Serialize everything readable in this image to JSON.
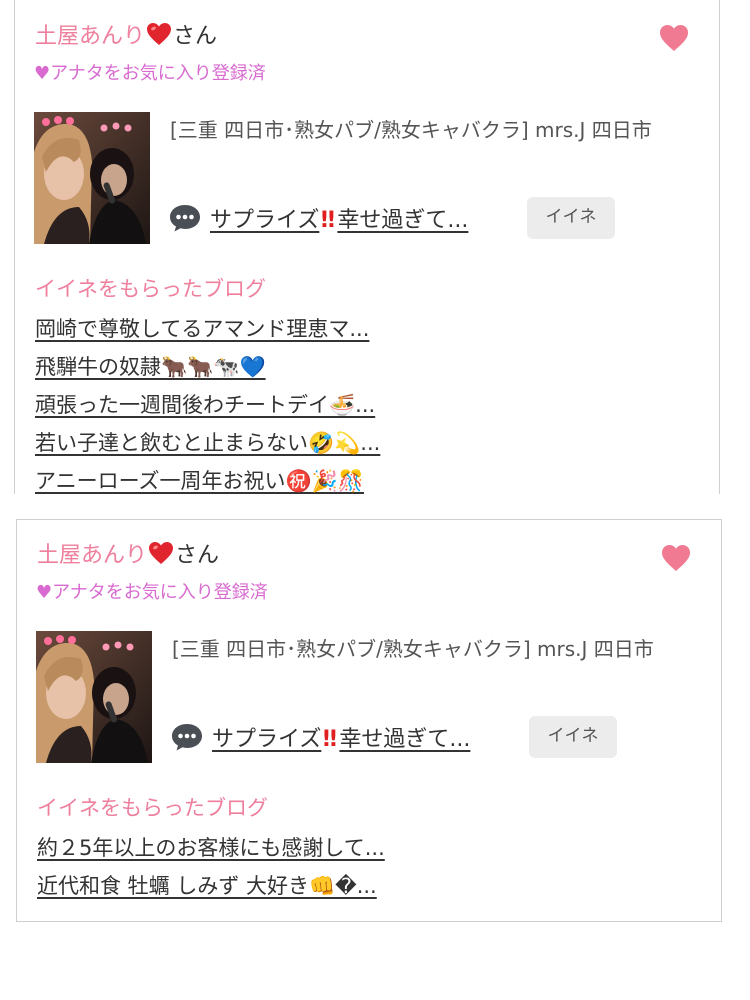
{
  "cards": [
    {
      "name": "土屋あんり",
      "heart": "❤️",
      "honorific": "さん",
      "favorite_status": "♥アナタをお気に入り登録済",
      "favorite_icon": "heart-icon",
      "shop": "[三重 四日市･熟女パブ/熟女キャバクラ]  mrs.J 四日市",
      "latest_blog": {
        "title_start": "サプライズ",
        "title_end": "幸せ過ぎて...",
        "icon": "speech-bubble-icon"
      },
      "iine_label": "イイネ",
      "liked_blogs_heading": "イイネをもらったブログ",
      "liked_blogs": [
        "岡崎で尊敬してるアマンド理恵マ...",
        "飛騨牛の奴隷🐂🐂🐄💙",
        "頑張った一週間後わチートデイ🍜...",
        "若い子達と飲むと止まらない🤣💫...",
        "アニーローズ一周年お祝い㊗️🎉🎊"
      ]
    },
    {
      "name": "土屋あんり",
      "heart": "❤️",
      "honorific": "さん",
      "favorite_status": "♥アナタをお気に入り登録済",
      "favorite_icon": "heart-icon",
      "shop": "[三重 四日市･熟女パブ/熟女キャバクラ]  mrs.J 四日市",
      "latest_blog": {
        "title_start": "サプライズ",
        "title_end": "幸せ過ぎて...",
        "icon": "speech-bubble-icon"
      },
      "iine_label": "イイネ",
      "liked_blogs_heading": "イイネをもらったブログ",
      "liked_blogs": [
        "約２5年以上のお客様にも感謝して...",
        "近代和食 牡蠣 しみず 大好き👊�..."
      ]
    }
  ],
  "colors": {
    "name_pink": "#ee7f9d",
    "favorite_purple": "#d86ad0",
    "heart_button": "#f07a92",
    "border": "#cfcfcf",
    "iine_bg": "#ececec"
  }
}
